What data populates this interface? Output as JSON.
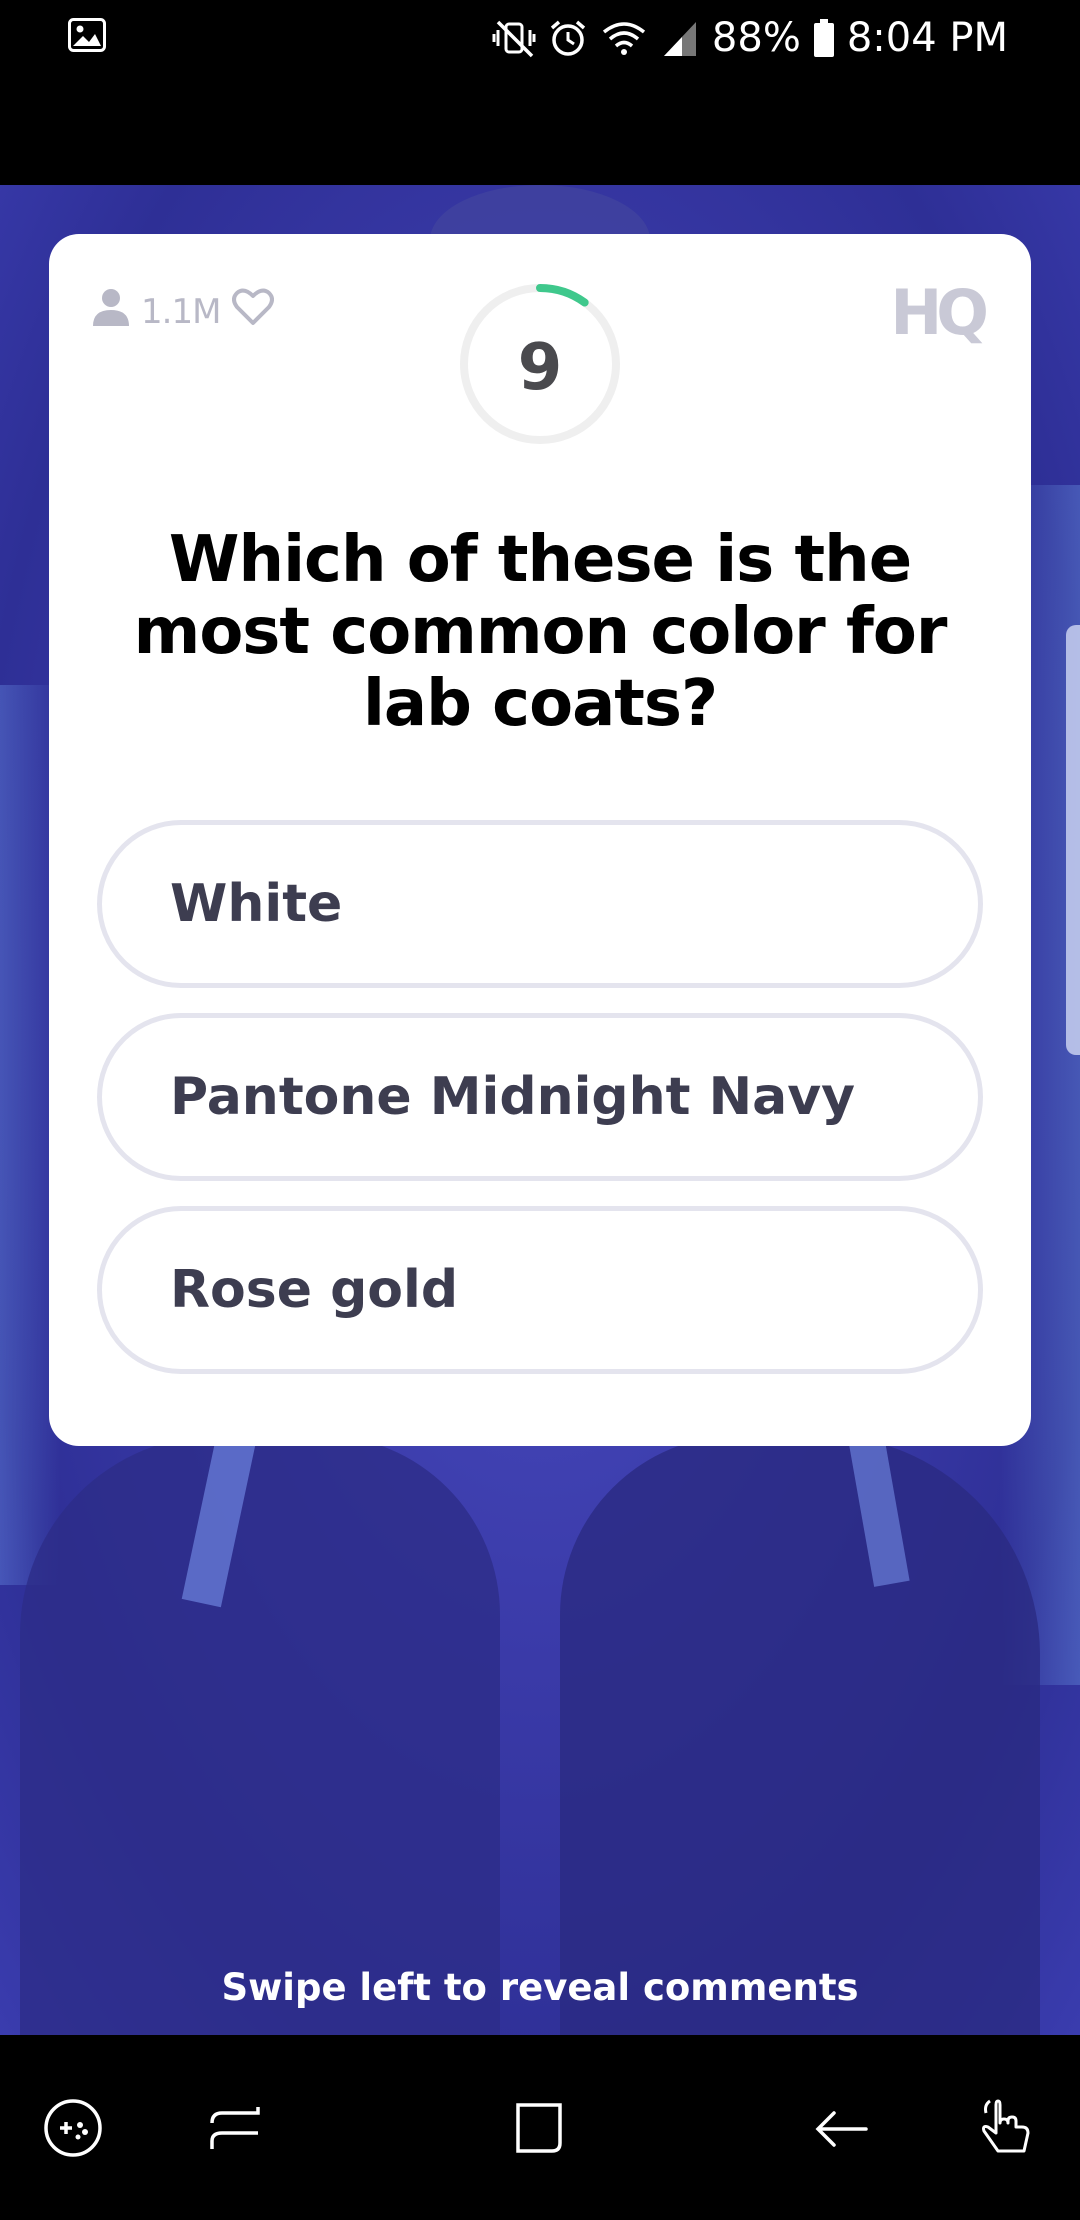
{
  "status_bar": {
    "battery": "88%",
    "time": "8:04 PM",
    "icons": [
      "image-icon",
      "mute-vibrate-icon",
      "alarm-icon",
      "wifi-icon",
      "signal-icon",
      "battery-icon"
    ]
  },
  "game": {
    "viewer_count": "1.1M",
    "logo": "HQ",
    "timer": {
      "seconds_left": "9",
      "progress_fraction": 0.1,
      "accent_color": "#3fc88c"
    },
    "question": "Which of these is the most common color for lab coats?",
    "answers": [
      {
        "label": "White"
      },
      {
        "label": "Pantone Midnight Navy"
      },
      {
        "label": "Rose gold"
      }
    ],
    "swipe_hint": "Swipe left to reveal comments"
  },
  "nav_bar": {
    "buttons": [
      "game-tools-icon",
      "recents-icon",
      "home-icon",
      "back-icon",
      "gesture-icon"
    ]
  },
  "colors": {
    "background_purple": "#3a3aa8",
    "card": "#ffffff",
    "answer_border": "#e4e4ee",
    "muted_text": "#b8b8c6"
  }
}
